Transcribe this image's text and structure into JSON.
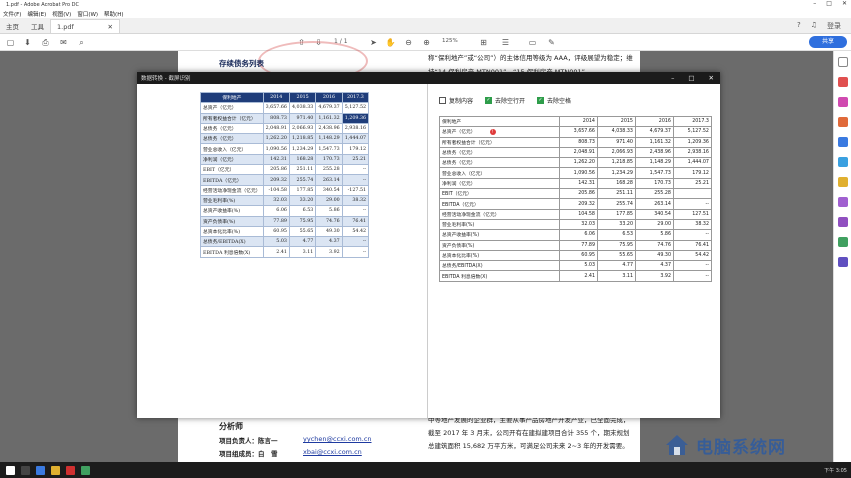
{
  "window": {
    "title": "1.pdf - Adobe Acrobat Pro DC"
  },
  "menubar": [
    "文件(F)",
    "编辑(E)",
    "视图(V)",
    "窗口(W)",
    "帮助(H)"
  ],
  "tabs": {
    "home": "主页",
    "tools": "工具",
    "doc": "1.pdf",
    "login": "登录"
  },
  "toolbar": {
    "page_current": "1",
    "page_sep": "/",
    "page_total": "1",
    "zoom": "125%",
    "share": "共享"
  },
  "page": {
    "section_title": "存续债务列表",
    "right_top": "称“保利地产”或“公司”）的主体信用等级为 AAA，评级展望为稳定；维持“14 保利房产 MTN001”、“15 保利房产 MTN001”。",
    "analyst_title": "分析师",
    "analysts": [
      {
        "label": "项目负责人：陈言一",
        "email": "yychen@ccxi.com.cn"
      },
      {
        "label": "项目组成员：白　雪",
        "email": "xbai@ccxi.com.cn"
      }
    ],
    "body_right": "中等地产发展的企业群，主要从事产品房地产开发产业，已全面完成，截至 2017 年 3 月末，公司开有在建拟建项目合计 355 个，期末规划总建筑面积 15,682 万平方米，可满足公司未来 2~3 年的开发需要。"
  },
  "dialog": {
    "title": "数据转换 - 截屏识别",
    "copy_label": "复制内容",
    "opt1": "去除空行开",
    "opt2": "去除空格",
    "headers": [
      "保利地产",
      "2014",
      "2015",
      "2016",
      "2017.3"
    ],
    "rows": [
      [
        "总资产（亿元）",
        "3,657.66",
        "4,038.33",
        "4,679.37",
        "5,127.52"
      ],
      [
        "所有者权益合计（亿元）",
        "808.73",
        "971.40",
        "1,161.32",
        "1,209.36"
      ],
      [
        "总债务（亿元）",
        "2,048.91",
        "2,066.93",
        "2,438.96",
        "2,938.16"
      ],
      [
        "总债务（亿元）",
        "1,262.20",
        "1,218.85",
        "1,148.29",
        "1,444.07"
      ],
      [
        "营业总收入（亿元）",
        "1,090.56",
        "1,234.29",
        "1,547.73",
        "179.12"
      ],
      [
        "净利润（亿元）",
        "142.31",
        "168.28",
        "170.73",
        "25.21"
      ],
      [
        "EBIT（亿元）",
        "205.86",
        "251.11",
        "255.28",
        "--"
      ],
      [
        "EBITDA（亿元）",
        "209.32",
        "255.74",
        "263.14",
        "--"
      ],
      [
        "经营活动净现金流（亿元）",
        "-104.58",
        "177.85",
        "340.54",
        "-127.51"
      ],
      [
        "营业毛利率(%)",
        "32.03",
        "33.20",
        "29.00",
        "38.32"
      ],
      [
        "总资产收益率(%)",
        "6.06",
        "6.53",
        "5.86",
        "--"
      ],
      [
        "资产负债率(%)",
        "77.89",
        "75.95",
        "74.76",
        "76.41"
      ],
      [
        "总资本化比率(%)",
        "60.95",
        "55.65",
        "49.30",
        "54.42"
      ],
      [
        "总债务/EBITDA(X)",
        "5.03",
        "4.77",
        "4.37",
        "--"
      ],
      [
        "EBITDA 利息倍数(X)",
        "2.41",
        "3.11",
        "3.92",
        "--"
      ]
    ],
    "ocr_rows": [
      [
        "总资产（亿元）",
        "3,657.66",
        "4,038.33",
        "4,679.37",
        "5,127.52"
      ],
      [
        "所有者权益合计（亿元）",
        "808.73",
        "971.40",
        "1,161.32",
        "1,209.36"
      ],
      [
        "总债务（亿元）",
        "2,048.91",
        "2,066.93",
        "2,438.96",
        "2,938.16"
      ],
      [
        "总债务（亿元）",
        "1,262.20",
        "1,218.85",
        "1,148.29",
        "1,444.07"
      ],
      [
        "营业总收入（亿元）",
        "1,090.56",
        "1,234.29",
        "1,547.73",
        "179.12"
      ],
      [
        "净利润（亿元）",
        "142.31",
        "168.28",
        "170.73",
        "25.21"
      ],
      [
        "EBIT（亿元）",
        "205.86",
        "251.11",
        "255.28",
        ""
      ],
      [
        "EBITDA（亿元）",
        "209.32",
        "255.74",
        "263.14",
        "--"
      ],
      [
        "经营活动净现金流（亿元）",
        "104.58",
        "177.85",
        "340.54",
        "127.51"
      ],
      [
        "营业毛利率(%)",
        "32.03",
        "33.20",
        "29.00",
        "38.32"
      ],
      [
        "总资产收益率(%)",
        "6.06",
        "6.53",
        "5.86",
        "--"
      ],
      [
        "资产负债率(%)",
        "77.89",
        "75.95",
        "74.76",
        "76.41"
      ],
      [
        "总资本化比率(%)",
        "60.95",
        "55.65",
        "49.30",
        "54.42"
      ],
      [
        "总债务/EBITDA(X)",
        "5.03",
        "4.77",
        "4.37",
        "--"
      ],
      [
        "EBITDA 利息倍数(X)",
        "2.41",
        "3.11",
        "3.92",
        "--"
      ]
    ]
  },
  "watermark": "电脑系统网",
  "taskbar": {
    "clock": "下午 3:05"
  },
  "colors": {
    "accent": "#2f6fde",
    "table_header": "#1f3d7a",
    "table_alt": "#dbe5f3",
    "check": "#2e9d4a"
  }
}
